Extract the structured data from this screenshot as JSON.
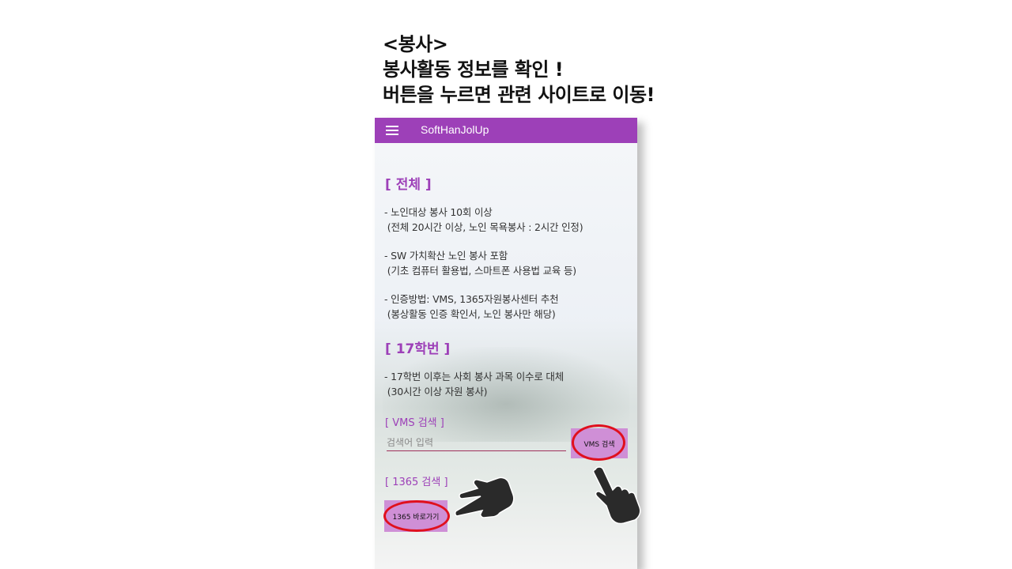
{
  "headline": {
    "line1": "<봉사>",
    "line2": "봉사활동 정보를 확인 !",
    "line3": "버튼을 누르면 관련 사이트로 이동!"
  },
  "app": {
    "title": "SoftHanJolUp"
  },
  "section_all": {
    "title": "[ 전체 ]",
    "item1": "- 노인대상 봉사 10회 이상\n (전체 20시간 이상, 노인 목욕봉사 : 2시간 인정)",
    "item2": "- SW 가치확산 노인 봉사 포함\n (기초 컴퓨터 활용법, 스마트폰 사용법 교육 등)",
    "item3": "- 인증방법: VMS, 1365자원봉사센터 추천\n (봉상활동 인증 확인서, 노인 봉사만 해당)"
  },
  "section_17": {
    "title": "[ 17학번 ]",
    "item1": "- 17학번 이후는 사회 봉사 과목 이수로 대체\n (30시간 이상 자원 봉사)"
  },
  "vms": {
    "title": "[ VMS 검색 ]",
    "placeholder": "검색어 입력",
    "button": "VMS 검색"
  },
  "k1365": {
    "title": "[ 1365 검색 ]",
    "button": "1365 바로가기"
  },
  "colors": {
    "appbar": "#9d40b8",
    "accent": "#9d40b8",
    "button": "#cf8fd6",
    "highlight_ring": "#e0101d"
  },
  "icons": [
    "menu-icon",
    "pointing-hand-icon"
  ]
}
